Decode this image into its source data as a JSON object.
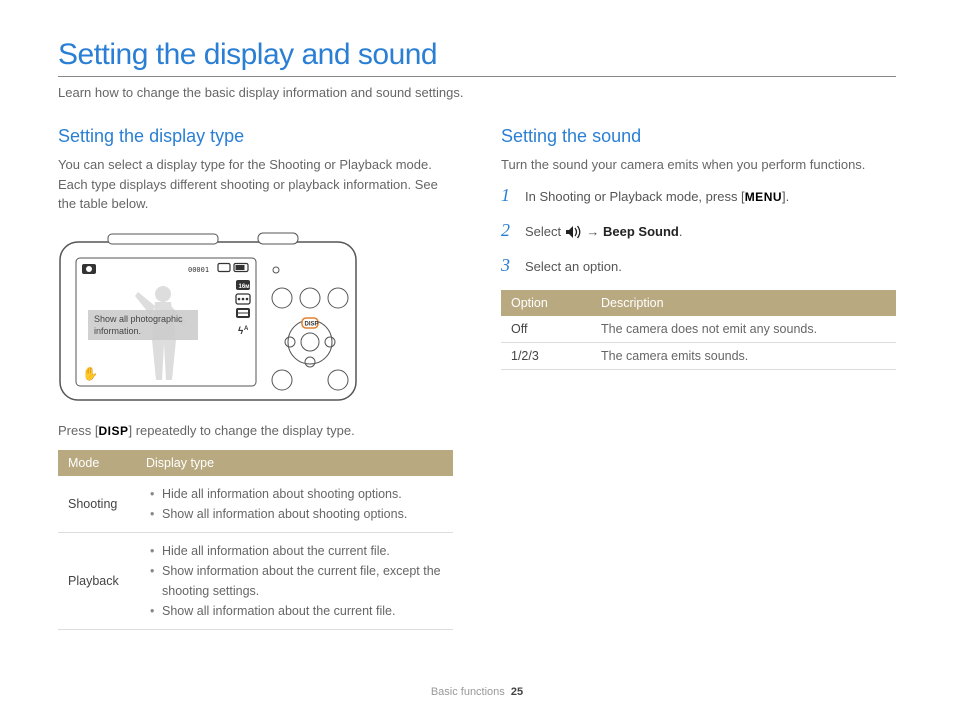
{
  "page": {
    "title": "Setting the display and sound",
    "intro": "Learn how to change the basic display information and sound settings."
  },
  "left": {
    "heading": "Setting the display type",
    "desc": "You can select a display type for the Shooting or Playback mode. Each type displays different shooting or playback information. See the table below.",
    "callout": "Show all photographic information.",
    "press_text_pre": "Press [",
    "press_text_post": "] repeatedly to change the display type.",
    "disp_label": "DISP",
    "table": {
      "h1": "Mode",
      "h2": "Display type",
      "r1_mode": "Shooting",
      "r1_items": [
        "Hide all information about shooting options.",
        "Show all information about shooting options."
      ],
      "r2_mode": "Playback",
      "r2_items": [
        "Hide all information about the current file.",
        "Show information about the current file, except the shooting settings.",
        "Show all information about the current file."
      ]
    }
  },
  "right": {
    "heading": "Setting the sound",
    "desc": "Turn the sound your camera emits when you perform functions.",
    "steps": {
      "s1_pre": "In Shooting or Playback mode, press [",
      "s1_menu": "MENU",
      "s1_post": "].",
      "s2_pre": "Select ",
      "s2_arrow": "→",
      "s2_bold": "Beep Sound",
      "s2_post": ".",
      "s3": "Select an option."
    },
    "table": {
      "h1": "Option",
      "h2": "Description",
      "r1_opt": "Off",
      "r1_desc": "The camera does not emit any sounds.",
      "r2_opt": "1/2/3",
      "r2_desc": "The camera emits sounds."
    }
  },
  "footer": {
    "section": "Basic functions",
    "page_num": "25"
  }
}
